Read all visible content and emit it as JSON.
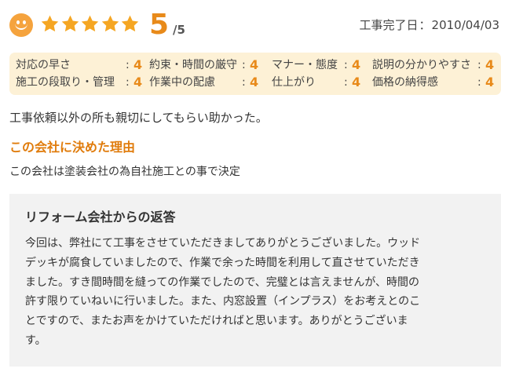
{
  "header": {
    "rating_score": "5",
    "rating_denominator": "/5",
    "star_count": 5,
    "star_color": "#f5a623",
    "smiley_icon": "smiley-face-icon",
    "date_label": "工事完了日",
    "date_separator": "：",
    "date_value": "2010/04/03"
  },
  "criteria": [
    {
      "label": "対応の早さ",
      "value": "4"
    },
    {
      "label": "約束・時間の厳守",
      "value": "4"
    },
    {
      "label": "マナー・態度",
      "value": "4"
    },
    {
      "label": "説明の分かりやすさ",
      "value": "4"
    },
    {
      "label": "施工の段取り・管理",
      "value": "4"
    },
    {
      "label": "作業中の配慮",
      "value": "4"
    },
    {
      "label": "仕上がり",
      "value": "4"
    },
    {
      "label": "価格の納得感",
      "value": "4"
    }
  ],
  "comment": "工事依頼以外の所も親切にしてもらい助かった。",
  "reason": {
    "heading": "この会社に決めた理由",
    "text": "この会社は塗装会社の為自社施工との事で決定"
  },
  "reply": {
    "heading": "リフォーム会社からの返答",
    "lines": [
      "今回は、弊社にて工事をさせていただきましてありがとうございました。ウッド",
      "デッキが腐食していましたので、作業で余った時間を利用して直させていただき",
      "ました。すき間時間を縫っての作業でしたので、完璧とは言えませんが、時間の",
      "許す限りていねいに行いました。また、内窓設置（インプラス）をお考えとのこ",
      "とですので、またお声をかけていただければと思います。ありがとうございま",
      "す。"
    ]
  },
  "colors": {
    "accent_orange": "#e88a1a",
    "criteria_bg": "#fdf1d6",
    "reply_bg": "#f2f2f2"
  }
}
